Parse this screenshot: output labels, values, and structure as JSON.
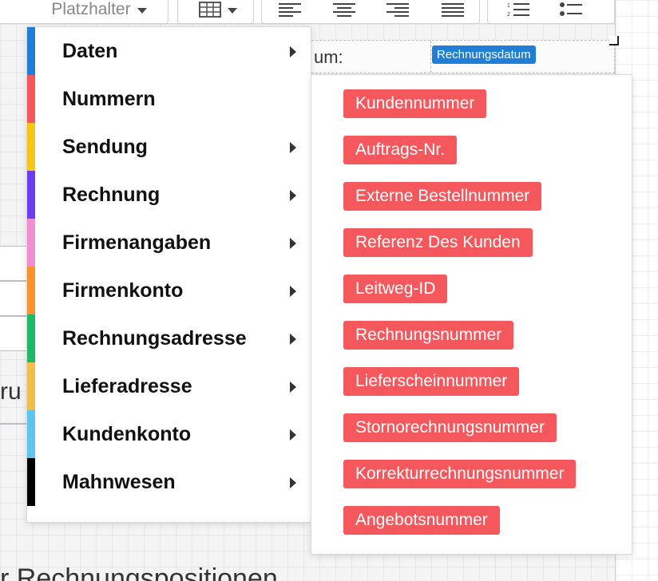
{
  "toolbar": {
    "placeholder_label": "Platzhalter",
    "icons": [
      "chevron-down-icon",
      "table-icon",
      "align-left-icon",
      "align-center-icon",
      "align-right-icon",
      "align-justify-icon",
      "ordered-list-icon",
      "bullet-list-icon"
    ]
  },
  "document": {
    "field_label": "um:",
    "field_tag": "Rechnungsdatum",
    "left_fragment": "ru",
    "bottom_fragment": "r Rechnungspositionen"
  },
  "menu": {
    "items": [
      {
        "label": "Daten",
        "color": "#1f7fd6",
        "submenu": true
      },
      {
        "label": "Nummern",
        "color": "#f4585d",
        "submenu": false
      },
      {
        "label": "Sendung",
        "color": "#f5c518",
        "submenu": true
      },
      {
        "label": "Rechnung",
        "color": "#6b3df0",
        "submenu": true
      },
      {
        "label": "Firmenangaben",
        "color": "#f08fd0",
        "submenu": true
      },
      {
        "label": "Firmenkonto",
        "color": "#f7922d",
        "submenu": true
      },
      {
        "label": "Rechnungsadresse",
        "color": "#1fb868",
        "submenu": true
      },
      {
        "label": "Lieferadresse",
        "color": "#f2bd4a",
        "submenu": true
      },
      {
        "label": "Kundenkonto",
        "color": "#5cc5f0",
        "submenu": true
      },
      {
        "label": "Mahnwesen",
        "color": "#000000",
        "submenu": true
      }
    ]
  },
  "submenu": {
    "tag_color": "#f4585d",
    "items": [
      "Kundennummer",
      "Auftrags-Nr.",
      "Externe Bestellnummer",
      "Referenz Des Kunden",
      "Leitweg-ID",
      "Rechnungsnummer",
      "Lieferscheinnummer",
      "Stornorechnungsnummer",
      "Korrekturrechnungsnummer",
      "Angebotsnummer"
    ]
  }
}
